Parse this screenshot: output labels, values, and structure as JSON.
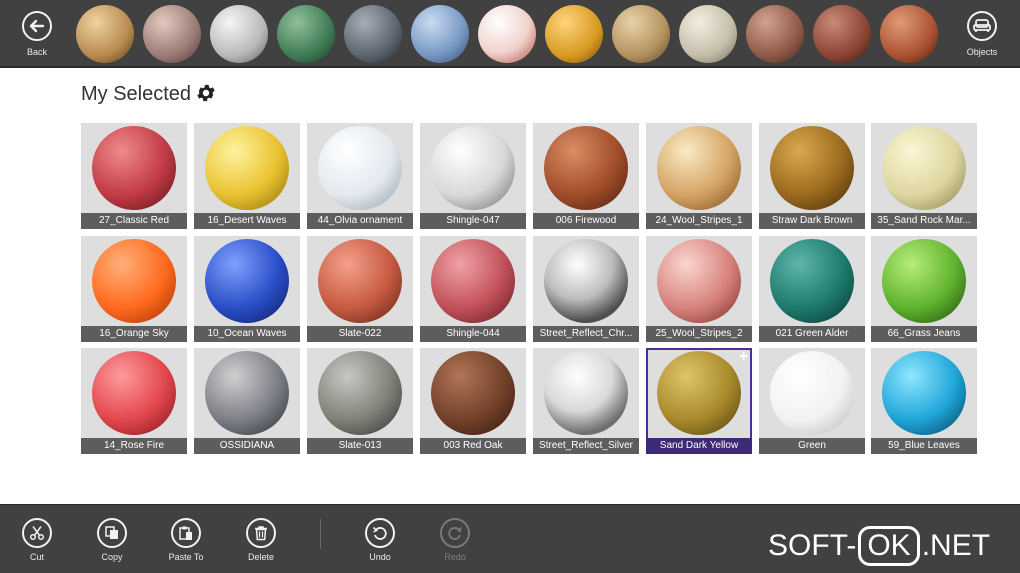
{
  "topbar": {
    "back_label": "Back",
    "objects_label": "Objects",
    "strip": [
      {
        "name": "parquet-light",
        "bg": "radial-gradient(circle at 35% 30%, #f0d3a0, #b78a50 60%, #5a3a18)"
      },
      {
        "name": "parquet-mauve",
        "bg": "radial-gradient(circle at 35% 30%, #e3c9c0, #9a7b76 60%, #4a3533)"
      },
      {
        "name": "white-shingle",
        "bg": "radial-gradient(circle at 35% 30%, #f5f5f5, #b9b9b9 60%, #5a5a5a)"
      },
      {
        "name": "green-scales",
        "bg": "radial-gradient(circle at 35% 30%, #8fbf9b, #3f7b55 60%, #1c3a27)"
      },
      {
        "name": "dark-stone",
        "bg": "radial-gradient(circle at 35% 30%, #a7aeb8, #5c6470 60%, #22272e)"
      },
      {
        "name": "blue-stone",
        "bg": "radial-gradient(circle at 35% 30%, #c9dcf2, #7596c2 60%, #30476b)"
      },
      {
        "name": "floral",
        "bg": "radial-gradient(circle at 35% 30%, #ffffff, #f1d2cc 55%, #b04a3e)"
      },
      {
        "name": "yellow-wood",
        "bg": "radial-gradient(circle at 35% 30%, #ffd47a, #d79a22 60%, #7a4c0a)"
      },
      {
        "name": "tan-wood",
        "bg": "radial-gradient(circle at 35% 30%, #e8d3a8, #b49160 60%, #5e4624)"
      },
      {
        "name": "cream-tile",
        "bg": "radial-gradient(circle at 35% 30%, #f1ede0, #c4bea9 60%, #6c6757)"
      },
      {
        "name": "brown-tile",
        "bg": "radial-gradient(circle at 35% 30%, #d3a290, #8e5a47 60%, #3e2318)"
      },
      {
        "name": "red-brown-tile",
        "bg": "radial-gradient(circle at 35% 30%, #c98a77, #8c4434 60%, #3b170f)"
      },
      {
        "name": "brick-tile",
        "bg": "radial-gradient(circle at 35% 30%, #e09a77, #ab5233 60%, #4a1c0c)"
      }
    ]
  },
  "header": {
    "title": "My Selected"
  },
  "materials": [
    {
      "label": "27_Classic Red",
      "bg": "radial-gradient(circle at 35% 30%, #f08a8a, #c23b45 55%, #5e121a)"
    },
    {
      "label": "16_Desert Waves",
      "bg": "radial-gradient(circle at 35% 30%, #fff3a0, #e9c230 55%, #8a6a06)"
    },
    {
      "label": "44_Olvia ornament",
      "bg": "radial-gradient(circle at 35% 30%, #ffffff, #e3e9ee 55%, #8f9aa4)"
    },
    {
      "label": "Shingle-047",
      "bg": "radial-gradient(circle at 35% 30%, #ffffff, #d8d8d8 55%, #6a6a6a)"
    },
    {
      "label": "006 Firewood",
      "bg": "radial-gradient(circle at 35% 30%, #d98e64, #a04d2a 55%, #4a1e0d)"
    },
    {
      "label": "24_Wool_Stripes_1",
      "bg": "radial-gradient(circle at 35% 30%, #fbeac4, #d4a465 55%, #7a4a1c)"
    },
    {
      "label": "Straw Dark Brown",
      "bg": "radial-gradient(circle at 35% 30%, #d8a94f, #9b6a1d 55%, #3f2706)"
    },
    {
      "label": "35_Sand Rock Mar...",
      "bg": "radial-gradient(circle at 35% 30%, #fbf6d4, #ddd6a0 55%, #827c4c)"
    },
    {
      "label": "16_Orange Sky",
      "bg": "radial-gradient(circle at 35% 30%, #ffb07a, #ff6a1e 55%, #9a2e00)"
    },
    {
      "label": "10_Ocean Waves",
      "bg": "radial-gradient(circle at 35% 30%, #7ea0ff, #2a4ec7 55%, #0b1a5c)"
    },
    {
      "label": "Slate-022",
      "bg": "radial-gradient(circle at 35% 30%, #f4a08a, #c65a42 55%, #5a1f12)"
    },
    {
      "label": "Shingle-044",
      "bg": "radial-gradient(circle at 35% 30%, #f0a1a6, #c2505a 55%, #5a1a20)"
    },
    {
      "label": "Street_Reflect_Chr...",
      "bg": "radial-gradient(circle at 40% 30%, #ffffff, #bdbdbd 45%, #4a4a4a 75%, #d6d6d6)"
    },
    {
      "label": "25_Wool_Stripes_2",
      "bg": "radial-gradient(circle at 35% 30%, #fbd5d0, #d7827d 55%, #7a2a28)"
    },
    {
      "label": "021 Green Alder",
      "bg": "radial-gradient(circle at 35% 30%, #5fb6aa, #1d7b6d 55%, #07302a)"
    },
    {
      "label": "66_Grass Jeans",
      "bg": "radial-gradient(circle at 35% 30%, #b6ee7a, #5fb22e 55%, #1f4a0a)"
    },
    {
      "label": "14_Rose Fire",
      "bg": "radial-gradient(circle at 35% 30%, #ff9a9c, #e2474c 55%, #7a1418)"
    },
    {
      "label": "OSSIDIANA",
      "bg": "radial-gradient(circle at 35% 30%, #d0d0d0, #7d7f86 55%, #2c2d32)"
    },
    {
      "label": "Slate-013",
      "bg": "radial-gradient(circle at 35% 30%, #c6c9c2, #7e8278 55%, #2f312c)"
    },
    {
      "label": "003 Red Oak",
      "bg": "radial-gradient(circle at 35% 30%, #b07556, #73412a 55%, #2e160a)"
    },
    {
      "label": "Street_Reflect_Silver",
      "bg": "radial-gradient(circle at 40% 30%, #ffffff, #d9d9d9 45%, #6b6b6b 75%, #e8e8e8)"
    },
    {
      "label": "Sand Dark Yellow",
      "bg": "radial-gradient(circle at 35% 30%, #e0c46a, #a88a2c 55%, #4a3a08)",
      "selected": true
    },
    {
      "label": "Green",
      "bg": "radial-gradient(circle at 35% 30%, #ffffff, #f2f2f2 55%, #b5b5b5)"
    },
    {
      "label": "59_Blue Leaves",
      "bg": "radial-gradient(circle at 35% 30%, #8fe6ff, #1fa6d9 55%, #053d57)"
    }
  ],
  "bottombar": {
    "cut": "Cut",
    "copy": "Copy",
    "paste_to": "Paste To",
    "delete": "Delete",
    "undo": "Undo",
    "redo": "Redo"
  },
  "watermark": {
    "left": "SOFT-",
    "box": "OK",
    "right": ".NET"
  },
  "colors": {
    "bar_bg": "#414141",
    "tile_bg": "#dedede",
    "caption_bg": "#5d5d5d",
    "selection": "#4b2d93"
  }
}
